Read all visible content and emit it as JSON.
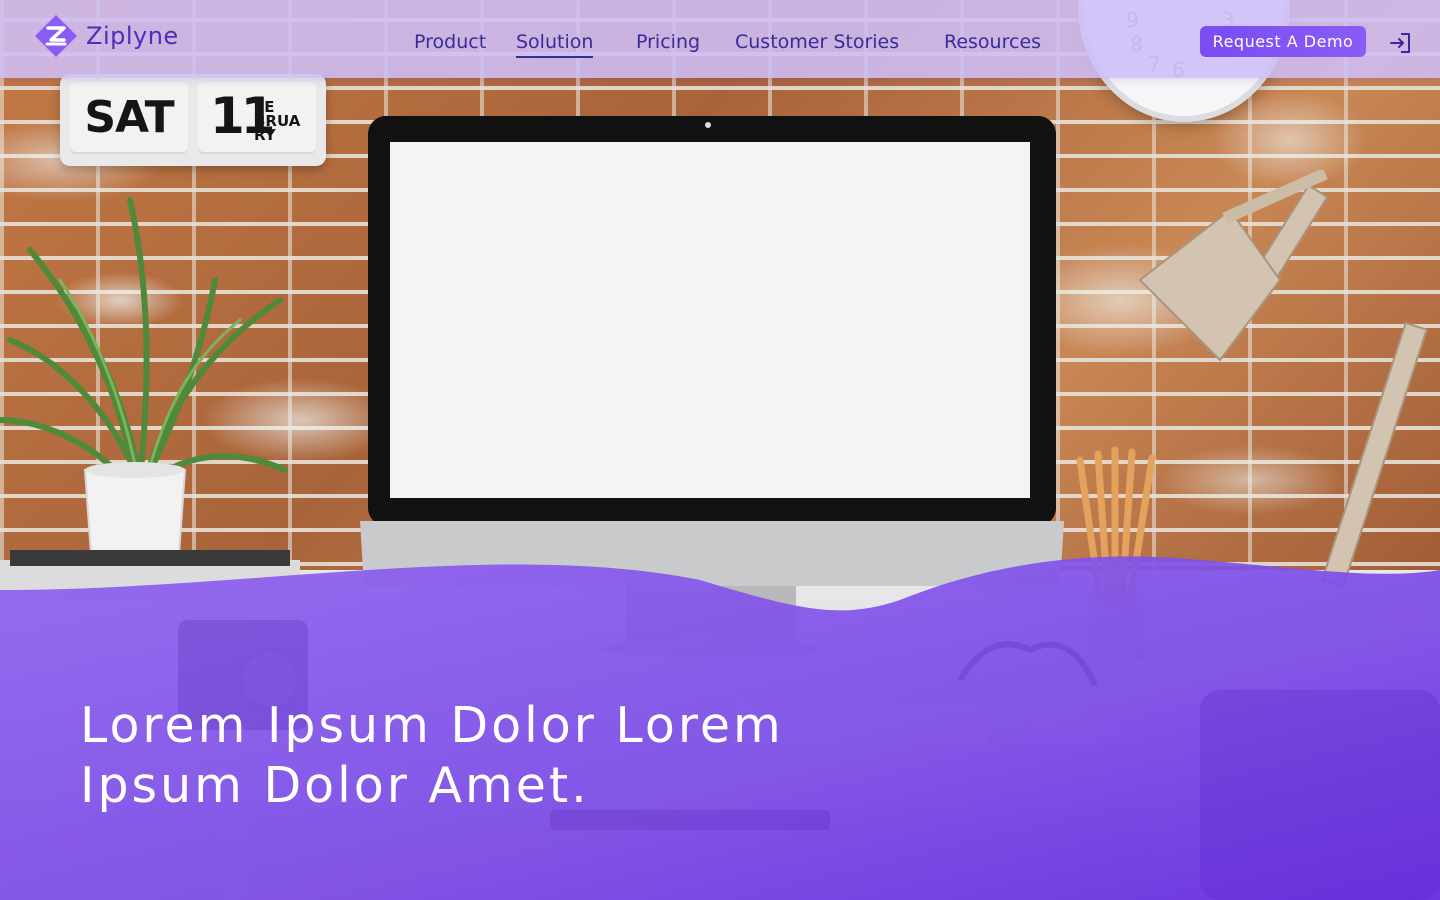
{
  "brand": {
    "name": "Ziplyne",
    "logo_letter": "Z",
    "primary_color": "#7a4cf2",
    "nav_text_color": "#3a2a9a"
  },
  "nav": {
    "items": [
      {
        "label": "Product",
        "active": false
      },
      {
        "label": "Solution",
        "active": true
      },
      {
        "label": "Pricing",
        "active": false
      },
      {
        "label": "Customer Stories",
        "active": false
      },
      {
        "label": "Resources",
        "active": false
      }
    ],
    "cta_label": "Request A Demo",
    "login_icon": "sign-in-icon"
  },
  "hero": {
    "heading": "Lorem Ipsum Dolor Lorem Ipsum Dolor Amet."
  },
  "background": {
    "calendar": {
      "day": "SAT",
      "date": "11",
      "month_lines": [
        "FE",
        "BRUA",
        "RY"
      ]
    },
    "clock_numbers": [
      "9",
      "8",
      "7",
      "6",
      "3"
    ]
  }
}
